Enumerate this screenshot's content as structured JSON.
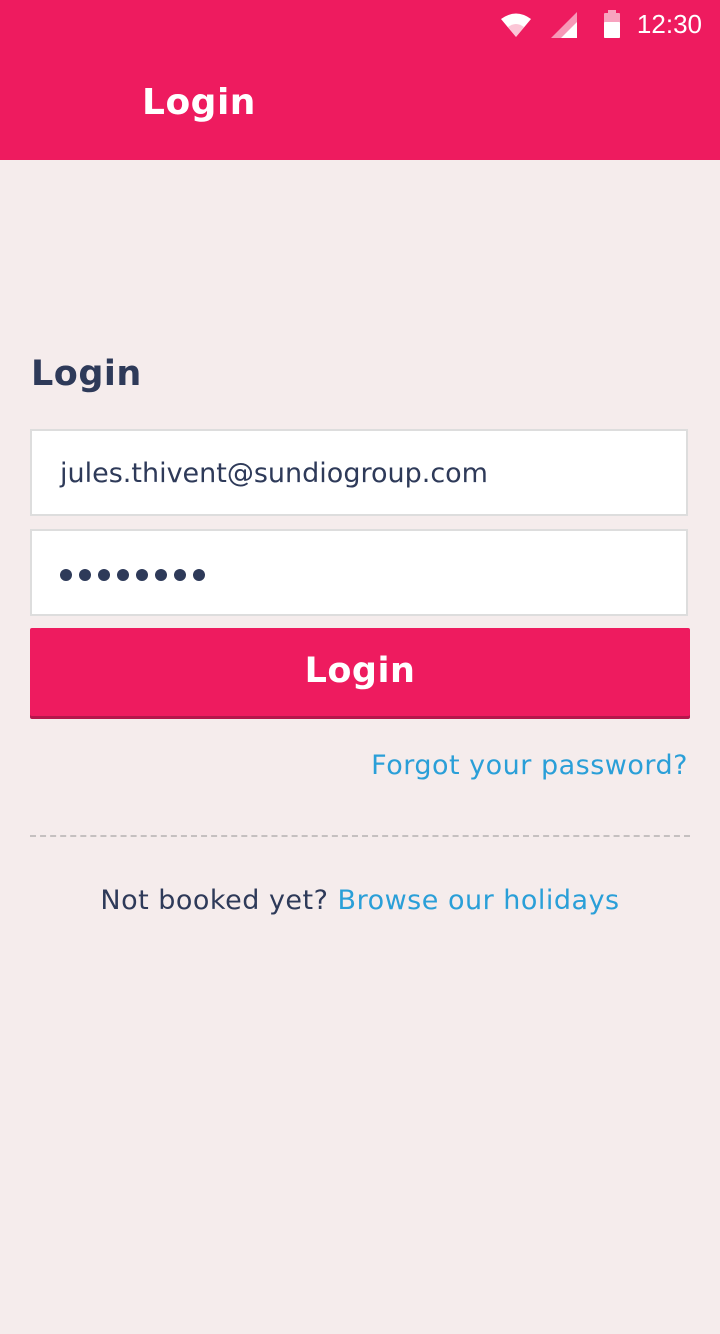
{
  "status_bar": {
    "time": "12:30"
  },
  "app_bar": {
    "title": "Login",
    "color": "#ee1b5f"
  },
  "form": {
    "heading": "Login",
    "email_value": "jules.thivent@sundiogroup.com",
    "password_masked_length": 8,
    "submit_label": "Login",
    "forgot_label": "Forgot your password?"
  },
  "footer": {
    "prompt": "Not booked yet?",
    "link_label": "Browse our holidays"
  },
  "colors": {
    "accent": "#ee1b5f",
    "link": "#2a9fd8",
    "text": "#2e3a59",
    "background": "#f5ecec"
  }
}
